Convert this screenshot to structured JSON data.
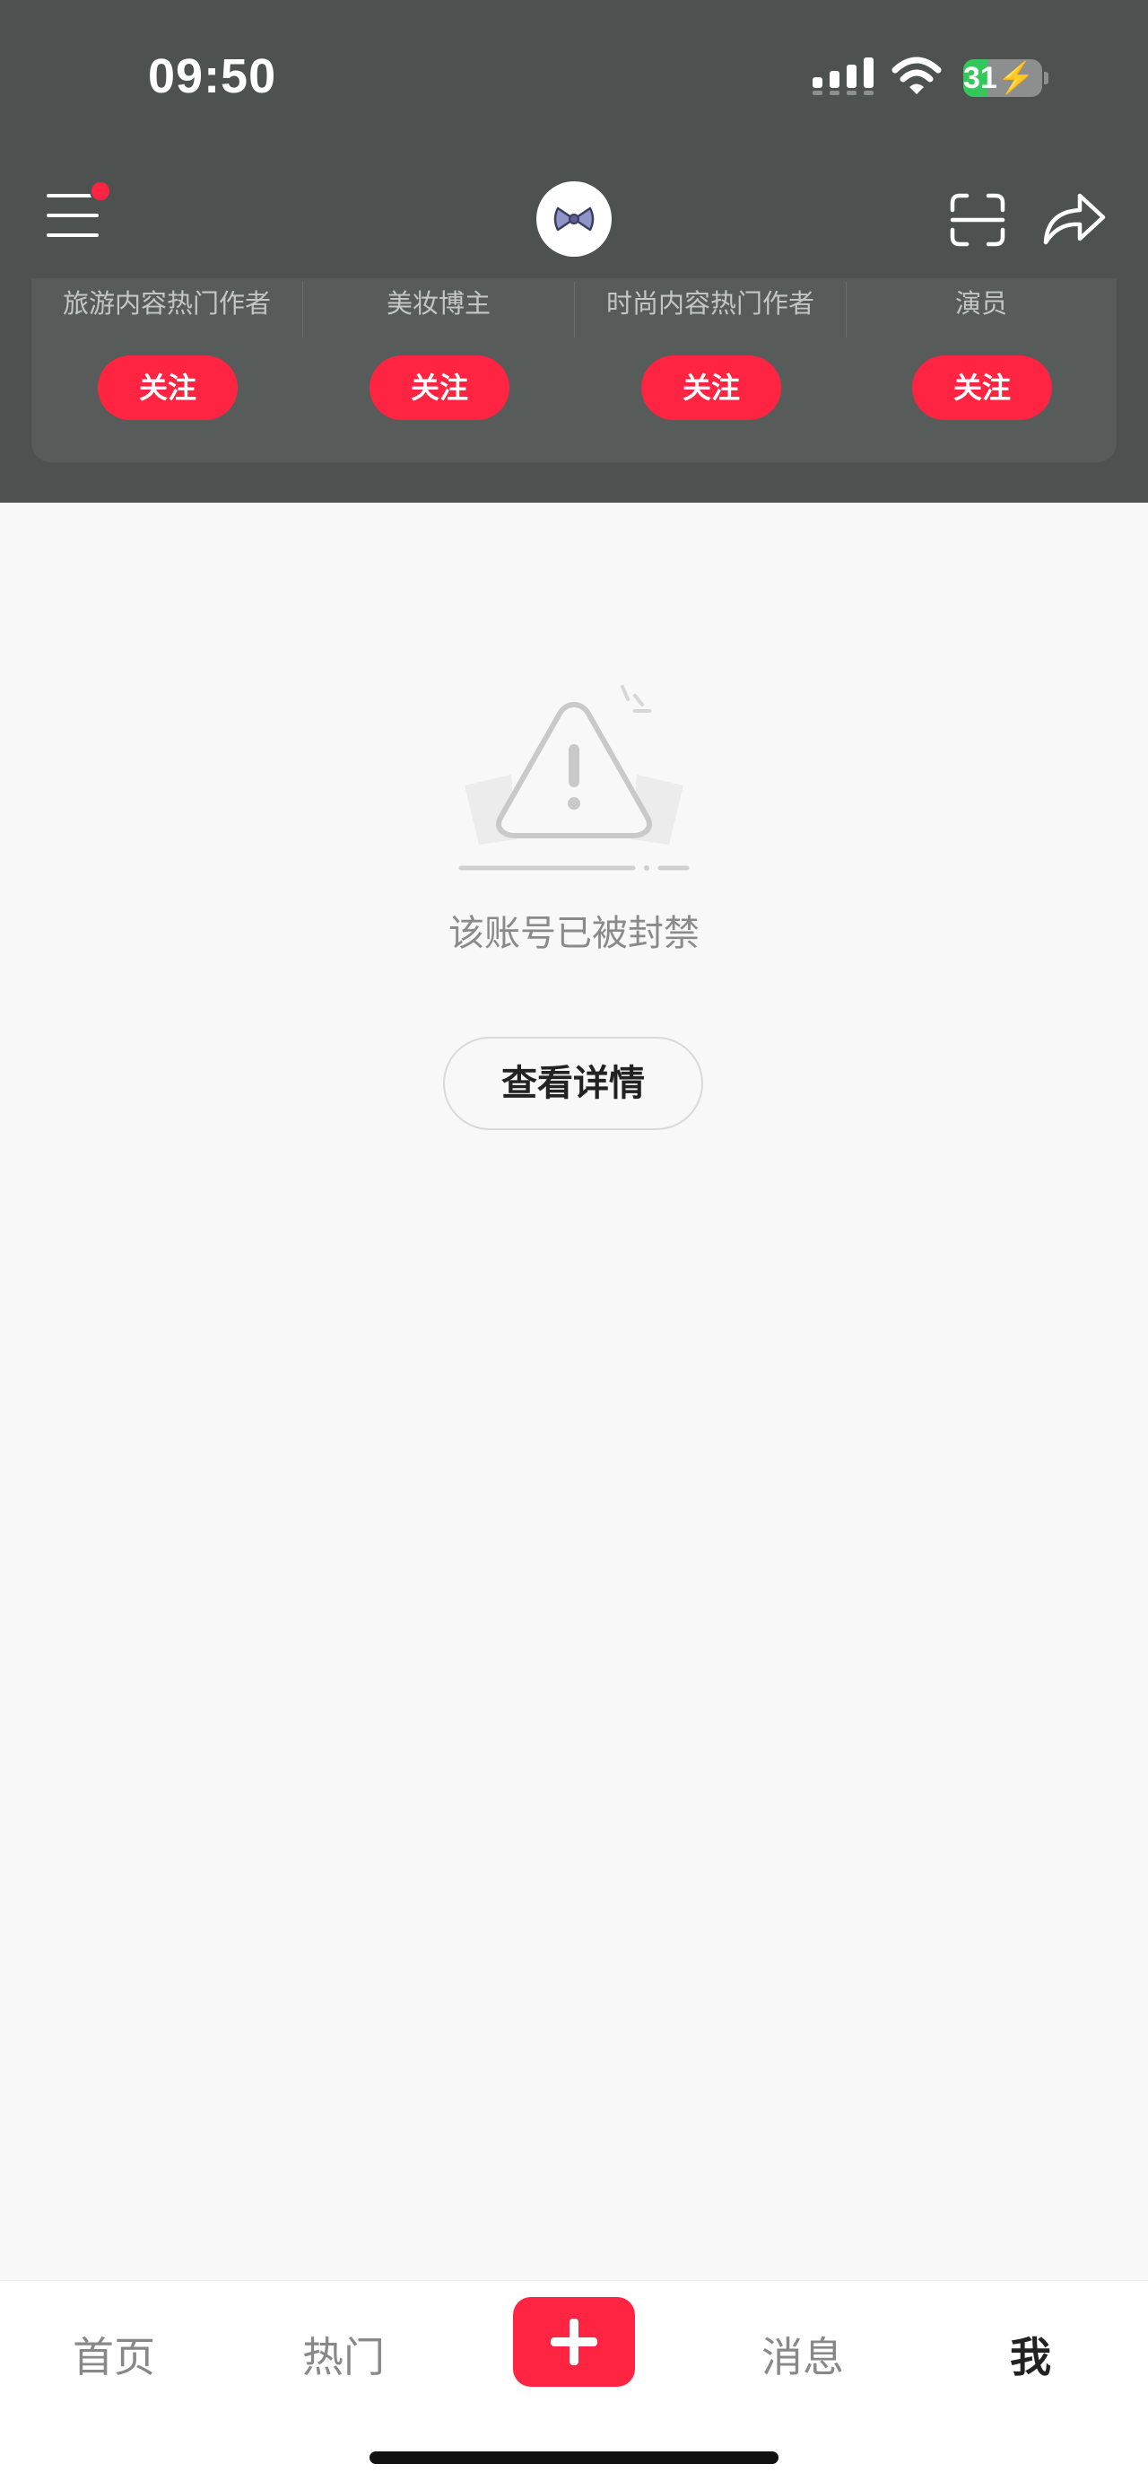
{
  "status_bar": {
    "time": "09:50",
    "battery_level": "31",
    "battery_fraction": 0.31,
    "battery_charging": true
  },
  "nav": {
    "has_notification_dot": true
  },
  "recommendations": [
    {
      "label": "旅游内容热门作者",
      "follow_label": "关注"
    },
    {
      "label": "美妆博主",
      "follow_label": "关注"
    },
    {
      "label": "时尚内容热门作者",
      "follow_label": "关注"
    },
    {
      "label": "演员",
      "follow_label": "关注"
    }
  ],
  "banned": {
    "message": "该账号已被封禁",
    "detail_button": "查看详情"
  },
  "tabbar": {
    "items": [
      {
        "label": "首页",
        "active": false
      },
      {
        "label": "热门",
        "active": false
      },
      {
        "label": "消息",
        "active": false
      },
      {
        "label": "我",
        "active": true
      }
    ]
  },
  "colors": {
    "header_bg": "#4d5250",
    "accent": "#ff2442",
    "page_bg": "#f8f8f8"
  },
  "icons": {
    "menu": "hamburger-icon",
    "avatar": "bow-avatar",
    "scan": "scan-icon",
    "share": "share-arrow-icon",
    "warning": "warning-triangle-icon",
    "plus": "plus-icon"
  }
}
